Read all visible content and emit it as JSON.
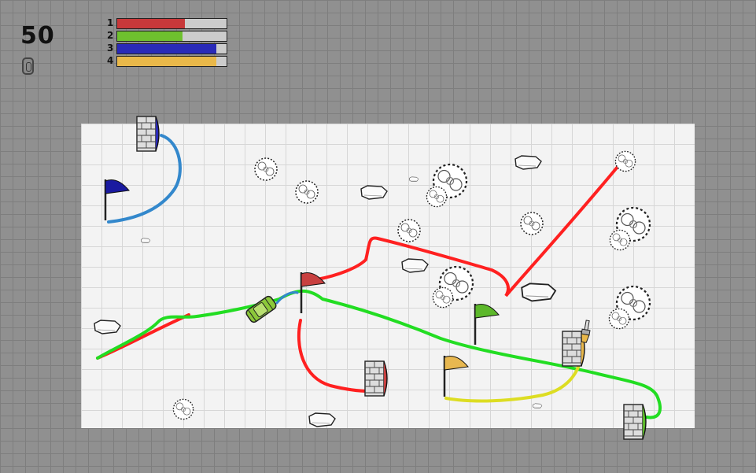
{
  "hud": {
    "score": "50",
    "score_icon": "tire-icon"
  },
  "players": [
    {
      "label": "1",
      "color": "#c8383a",
      "progress": 0.62
    },
    {
      "label": "2",
      "color": "#6ec02e",
      "progress": 0.6
    },
    {
      "label": "3",
      "color": "#2a2ab8",
      "progress": 0.91
    },
    {
      "label": "4",
      "color": "#e9b84a",
      "progress": 0.91
    }
  ],
  "track_colors": {
    "red": "#ff2020",
    "green": "#22dd22",
    "blue": "#3388cc",
    "yellow": "#dddd22"
  },
  "flags": [
    {
      "name": "flag-blue",
      "color": "#1a1aa0"
    },
    {
      "name": "flag-red",
      "color": "#c84040"
    },
    {
      "name": "flag-green",
      "color": "#5cb82a"
    },
    {
      "name": "flag-yellow",
      "color": "#e8b850"
    }
  ],
  "garages": [
    {
      "name": "garage-blue",
      "color": "#2a2ab8"
    },
    {
      "name": "garage-red",
      "color": "#c84040"
    },
    {
      "name": "garage-yellow",
      "color": "#e9b84a"
    },
    {
      "name": "garage-green",
      "color": "#5cb82a"
    }
  ],
  "icons": {
    "car": "car-icon",
    "brush": "paintbrush-icon",
    "tree": "tree-icon",
    "rock": "rock-icon"
  }
}
